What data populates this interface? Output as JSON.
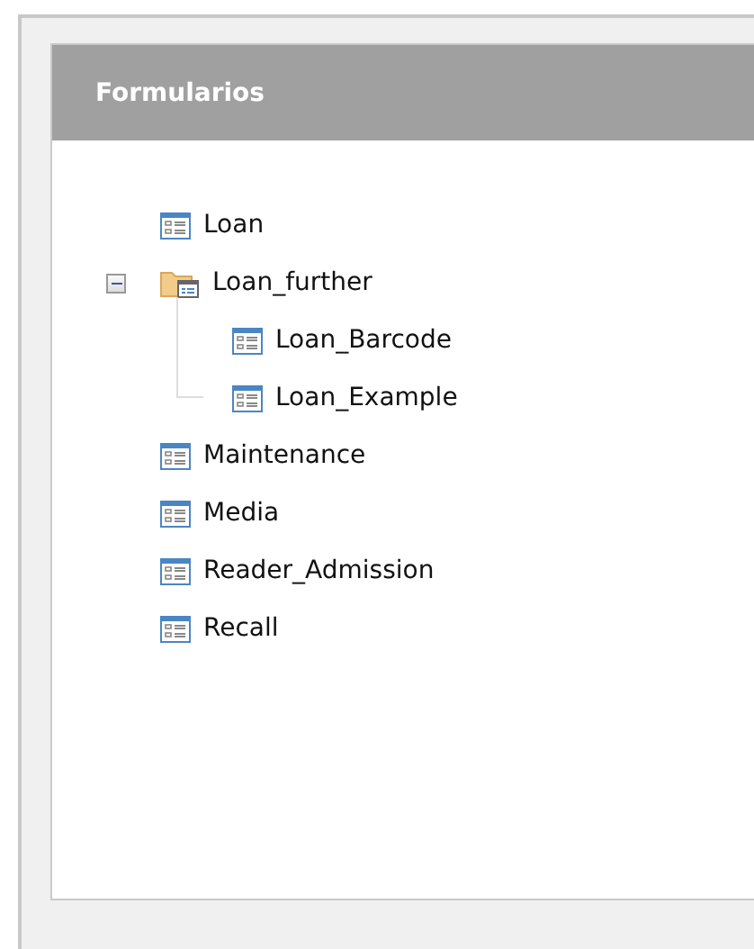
{
  "panel": {
    "title": "Formularios"
  },
  "tree": [
    {
      "label": "Loan",
      "kind": "form"
    },
    {
      "label": "Loan_further",
      "kind": "folder",
      "expanded": true,
      "children": [
        {
          "label": "Loan_Barcode",
          "kind": "form"
        },
        {
          "label": "Loan_Example",
          "kind": "form"
        }
      ]
    },
    {
      "label": "Maintenance",
      "kind": "form"
    },
    {
      "label": "Media",
      "kind": "form"
    },
    {
      "label": "Reader_Admission",
      "kind": "form"
    },
    {
      "label": "Recall",
      "kind": "form"
    }
  ]
}
